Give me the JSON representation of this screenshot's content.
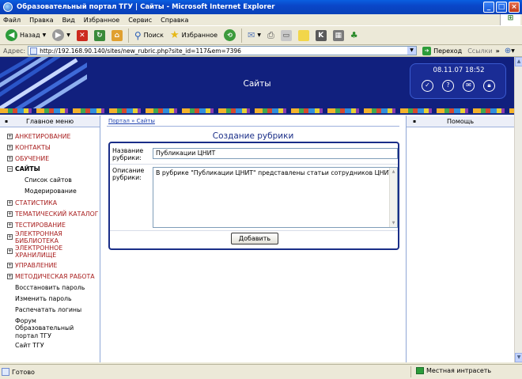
{
  "window": {
    "title": "Образовательный портал ТГУ | Сайты - Microsoft Internet Explorer",
    "minimize": "_",
    "maximize": "□",
    "close": "×"
  },
  "menubar": [
    "Файл",
    "Правка",
    "Вид",
    "Избранное",
    "Сервис",
    "Справка"
  ],
  "toolbar": {
    "back": "Назад",
    "search": "Поиск",
    "favorites": "Избранное"
  },
  "addressbar": {
    "label": "Адрес:",
    "url": "http://192.168.90.140/sites/new_rubric.php?site_id=117&em=7396",
    "go": "Переход",
    "links": "Ссылки"
  },
  "header": {
    "title": "Сайты",
    "datetime": "08.11.07 18:52"
  },
  "leftmenu": {
    "heading": "Главное меню",
    "items": [
      {
        "label": "Анкетирование"
      },
      {
        "label": "Контакты"
      },
      {
        "label": "Обучение"
      },
      {
        "label": "Сайты"
      },
      {
        "label": "Статистика"
      },
      {
        "label": "Тематический каталог"
      },
      {
        "label": "Тестирование"
      },
      {
        "label": "Электронная библиотека"
      },
      {
        "label": "Электронное хранилище"
      },
      {
        "label": "Управление"
      },
      {
        "label": "Методическая работа"
      }
    ],
    "subitems": [
      "Список сайтов",
      "Модерирование"
    ],
    "links": [
      "Восстановить пароль",
      "Изменить пароль",
      "Распечатать логины",
      "Форум",
      "Образовательный портал ТГУ",
      "Сайт ТГУ"
    ]
  },
  "breadcrumb": {
    "home": "Портал",
    "sep": " » ",
    "current": "Сайты"
  },
  "form": {
    "title": "Создание рубрики",
    "name_label": "Название рубрики:",
    "name_value": "Публикации ЦНИТ",
    "desc_label": "Описание рубрики:",
    "desc_value": "В рубрике \"Публикации ЦНИТ\" представлены статьи сотрудников ЦНИТ",
    "submit": "Добавить"
  },
  "rightpanel": {
    "heading": "Помощь"
  },
  "statusbar": {
    "left": "Готово",
    "zone": "Местная интрасеть"
  }
}
